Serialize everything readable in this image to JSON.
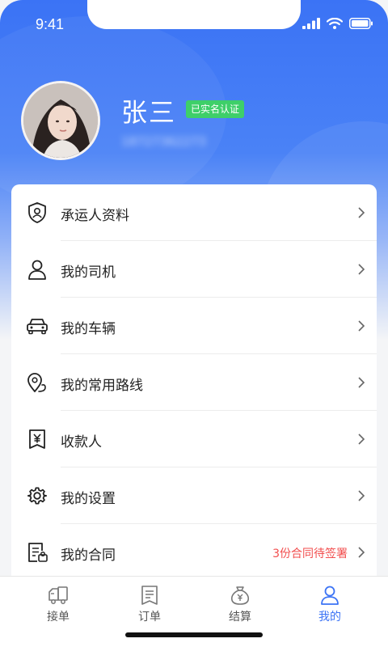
{
  "status_bar": {
    "time": "9:41"
  },
  "profile": {
    "name": "张三",
    "verified_badge": "已实名认证",
    "phone": "18727362273"
  },
  "menu": {
    "items": [
      {
        "label": "承运人资料",
        "icon": "shield-user-icon"
      },
      {
        "label": "我的司机",
        "icon": "person-icon"
      },
      {
        "label": "我的车辆",
        "icon": "car-icon"
      },
      {
        "label": "我的常用路线",
        "icon": "location-route-icon"
      },
      {
        "label": "收款人",
        "icon": "yen-receipt-icon"
      },
      {
        "label": "我的设置",
        "icon": "gear-icon"
      },
      {
        "label": "我的合同",
        "icon": "contract-icon",
        "extra": "3份合同待签署"
      }
    ]
  },
  "tab_bar": {
    "tabs": [
      {
        "label": "接单",
        "icon": "truck-icon",
        "active": false
      },
      {
        "label": "订单",
        "icon": "order-list-icon",
        "active": false
      },
      {
        "label": "结算",
        "icon": "money-bag-icon",
        "active": false
      },
      {
        "label": "我的",
        "icon": "profile-icon",
        "active": true
      }
    ]
  },
  "colors": {
    "primary": "#3b73f5",
    "verified_green": "#3ecf69",
    "alert_red": "#f24e4e"
  }
}
